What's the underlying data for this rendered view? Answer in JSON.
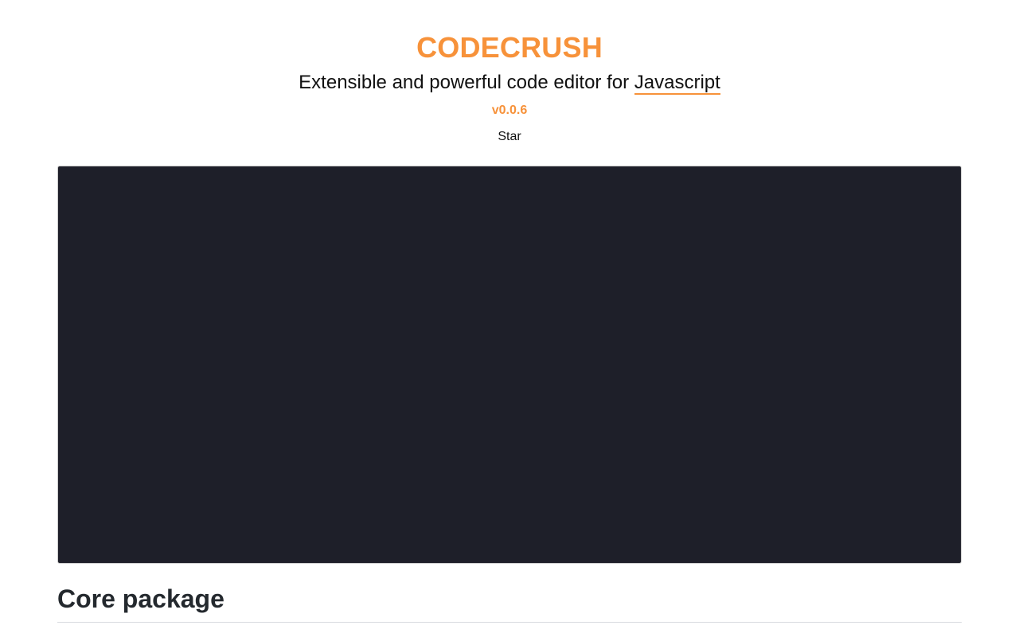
{
  "header": {
    "title": "CODECRUSH",
    "subtitle_prefix": "Extensible and powerful code editor for ",
    "subtitle_link": "Javascript",
    "version": "v0.0.6",
    "star_label": "Star"
  },
  "editor": {
    "content": ""
  },
  "sections": {
    "core_title": "Core package"
  },
  "colors": {
    "accent": "#f7923a",
    "editor_background": "#1e1f29",
    "text": "#111111"
  }
}
